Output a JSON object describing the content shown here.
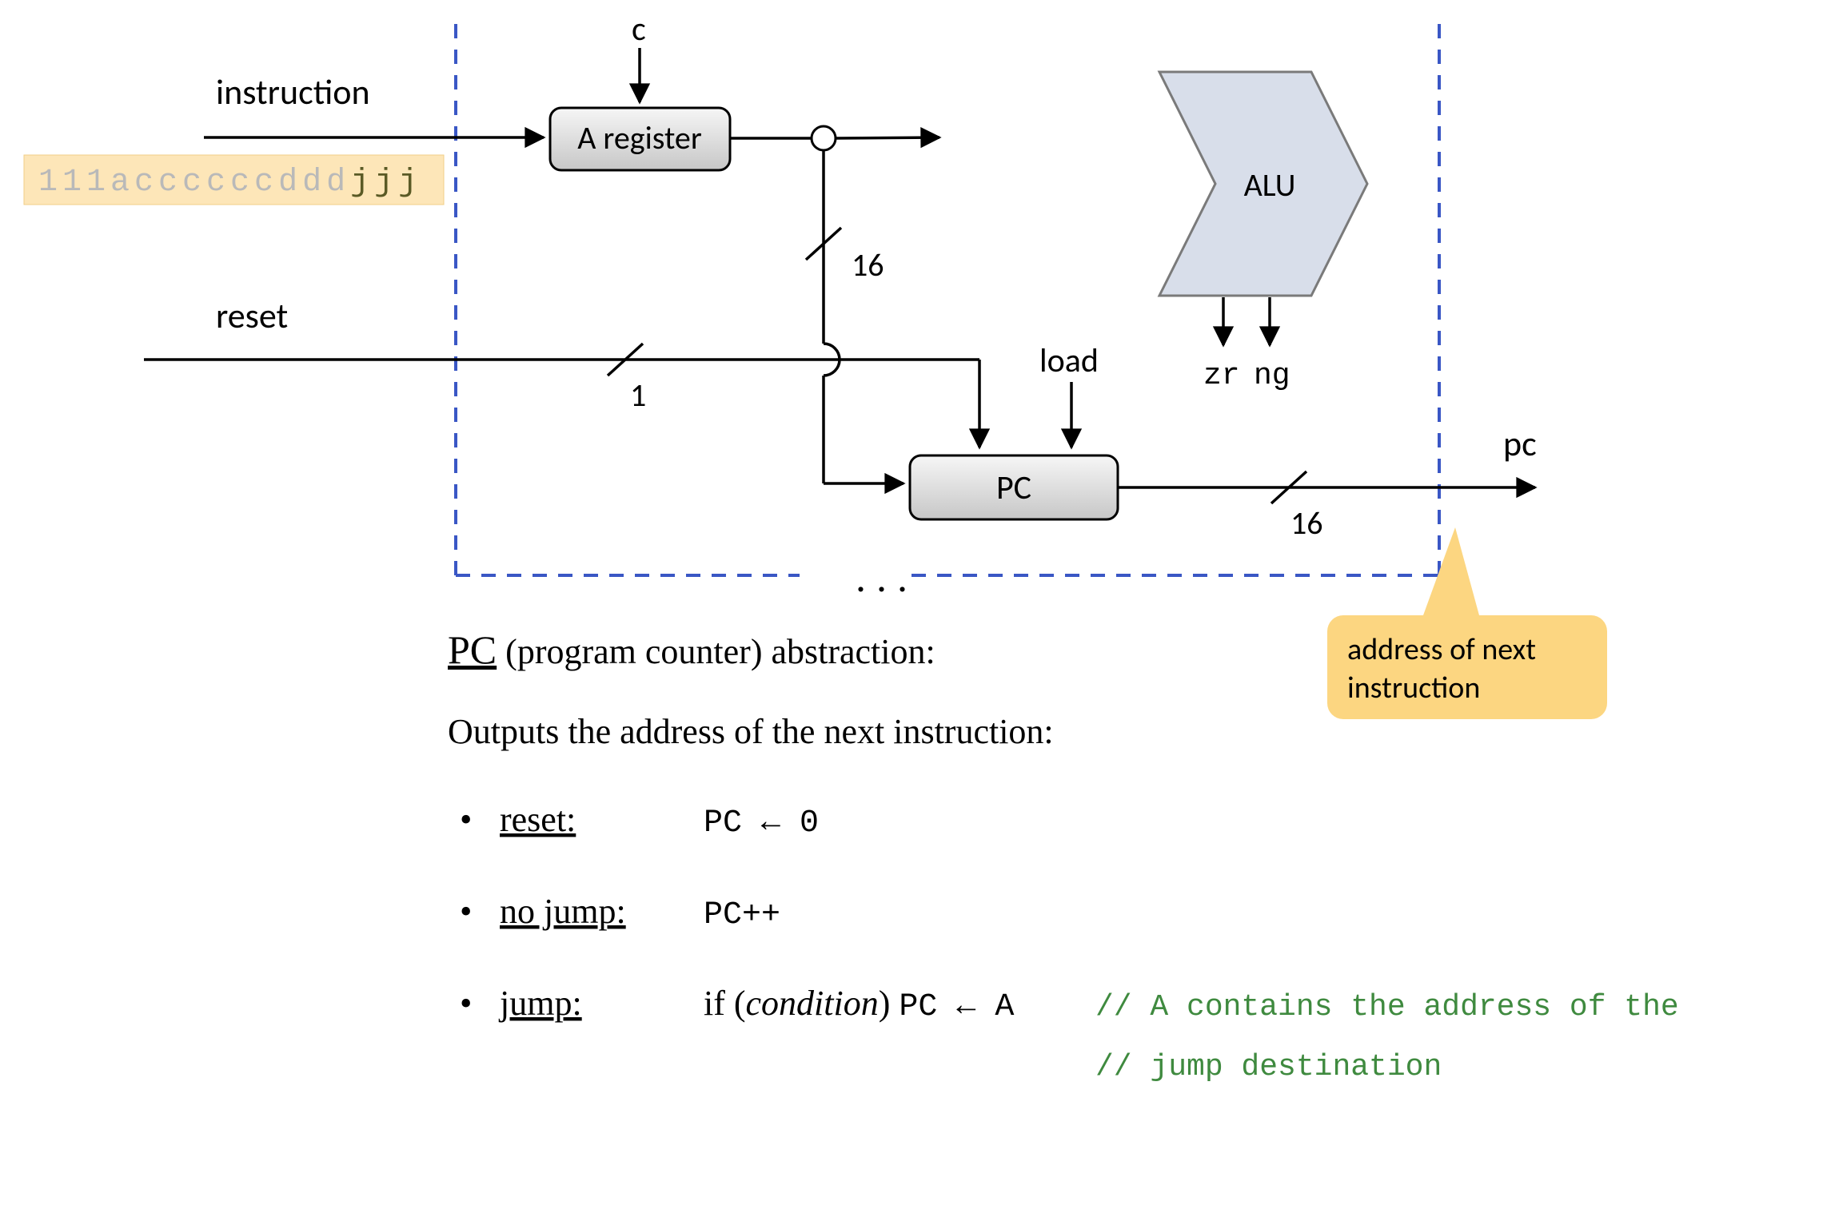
{
  "labels": {
    "instruction": "instruction",
    "reset": "reset",
    "a_register": "A register",
    "c": "c",
    "alu": "ALU",
    "zr": "zr",
    "ng": "ng",
    "load": "load",
    "pc_box": "PC",
    "pc_out": "pc",
    "bus16_upper": "16",
    "bus1": "1",
    "bus16_lower": "16",
    "dots": ". . .",
    "callout_l1": "address of next",
    "callout_l2": "instruction",
    "instr_bits_gray1": "111",
    "instr_bits_gray2": "a",
    "instr_bits_gray3": "cccccc",
    "instr_bits_gray4": "ddd",
    "instr_bits_hl": "jjj"
  },
  "text": {
    "heading_pc": "PC",
    "heading_rest": " (program counter) abstraction:",
    "line2": "Outputs the address of the next instruction:",
    "b1_label": "reset:",
    "b1_code": "PC ← 0",
    "b2_label": "no jump:",
    "b2_code": "PC++",
    "b3_label": "jump:",
    "b3_if": "if (",
    "b3_cond": "condition",
    "b3_close": ") ",
    "b3_code": "PC ← A",
    "b3_comment1": "// A  contains the address of the",
    "b3_comment2": "// jump destination"
  }
}
